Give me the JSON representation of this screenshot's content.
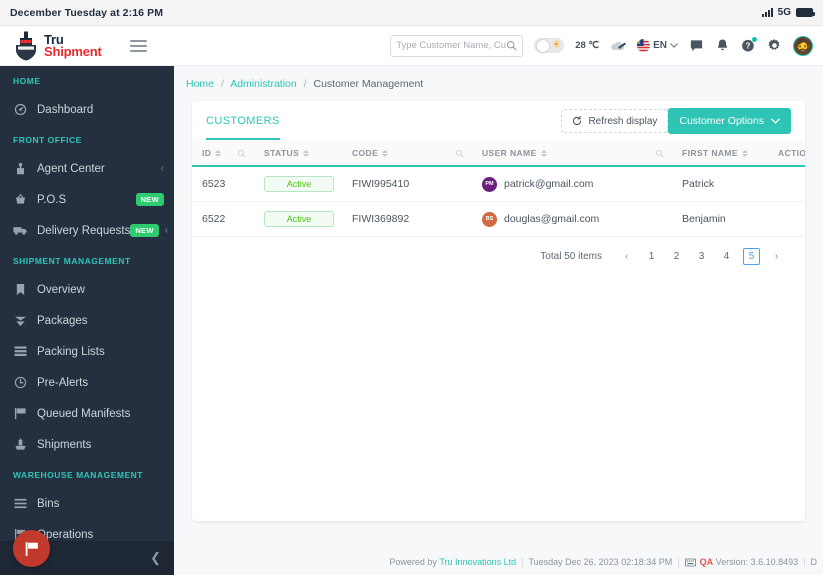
{
  "statusbar": {
    "clock": "December Tuesday at 2:16 PM",
    "network": "5G",
    "signal_icon": "signal-bars-icon",
    "battery_icon": "battery-icon"
  },
  "header": {
    "logo": {
      "line1": "Tru",
      "line2": "Shipment",
      "icon": "ship-shield-logo-icon"
    },
    "menu_toggle_icon": "hamburger-menu-icon",
    "search": {
      "placeholder": "Type Customer Name, Cu...",
      "value": "",
      "icon": "search-icon"
    },
    "theme_toggle": {
      "state": "off",
      "icon": "sun-icon"
    },
    "weather": {
      "temperature": "28 ℃",
      "icon": "cloud-icon"
    },
    "language": {
      "code": "EN",
      "flag": "malaysia-flag-icon",
      "chevron": "chevron-down-icon"
    },
    "icons": [
      {
        "name": "chat-icon",
        "badge": false
      },
      {
        "name": "bell-icon",
        "badge": false
      },
      {
        "name": "help-icon",
        "badge": true
      },
      {
        "name": "gear-icon",
        "badge": false
      }
    ],
    "avatar": {
      "name": "user-avatar",
      "glyph": "🧔"
    }
  },
  "sidebar": {
    "sections": [
      {
        "title": "HOME",
        "items": [
          {
            "label": "Dashboard",
            "icon": "speedometer-icon",
            "badge": null,
            "arrow": false
          }
        ]
      },
      {
        "title": "FRONT OFFICE",
        "items": [
          {
            "label": "Agent Center",
            "icon": "agent-icon",
            "badge": null,
            "arrow": true
          },
          {
            "label": "P.O.S",
            "icon": "basket-icon",
            "badge": "NEW",
            "arrow": false
          },
          {
            "label": "Delivery Requests",
            "icon": "truck-icon",
            "badge": "NEW",
            "arrow": true
          }
        ]
      },
      {
        "title": "SHIPMENT MANAGEMENT",
        "items": [
          {
            "label": "Overview",
            "icon": "bookmark-icon",
            "badge": null,
            "arrow": false
          },
          {
            "label": "Packages",
            "icon": "package-icon",
            "badge": null,
            "arrow": false
          },
          {
            "label": "Packing Lists",
            "icon": "list-icon",
            "badge": null,
            "arrow": false
          },
          {
            "label": "Pre-Alerts",
            "icon": "clock-icon",
            "badge": null,
            "arrow": false
          },
          {
            "label": "Queued Manifests",
            "icon": "flag-icon",
            "badge": null,
            "arrow": false
          },
          {
            "label": "Shipments",
            "icon": "shipment-icon",
            "badge": null,
            "arrow": false
          }
        ]
      },
      {
        "title": "WAREHOUSE MANAGEMENT",
        "items": [
          {
            "label": "Bins",
            "icon": "bins-icon",
            "badge": null,
            "arrow": false
          },
          {
            "label": "Operations",
            "icon": "operations-icon",
            "badge": null,
            "arrow": false
          }
        ]
      }
    ],
    "collapse_icon": "chevron-left-icon",
    "fab_icon": "flag-icon"
  },
  "breadcrumb": {
    "home": "Home",
    "administration": "Administration",
    "current": "Customer Management"
  },
  "card": {
    "tab": "CUSTOMERS",
    "refresh_label": "Refresh display",
    "refresh_icon": "refresh-icon",
    "options_label": "Customer Options",
    "options_chevron": "chevron-down-icon",
    "columns": [
      "ID",
      "STATUS",
      "CODE",
      "USER NAME",
      "FIRST NAME",
      "ACTION"
    ],
    "rows": [
      {
        "id": "6523",
        "status": "Active",
        "code": "FIWI995410",
        "username": "patrick@gmail.com",
        "avatar_initials": "PM",
        "avatar_color": "#6b1f7a",
        "firstname": "Patrick",
        "action_icon": "kebab-menu-icon"
      },
      {
        "id": "6522",
        "status": "Active",
        "code": "FIWI369892",
        "username": "douglas@gmail.com",
        "avatar_initials": "BS",
        "avatar_color": "#d2693f",
        "firstname": "Benjamin",
        "action_icon": "kebab-menu-icon"
      }
    ],
    "pagination": {
      "total_label": "Total 50 items",
      "prev_icon": "chevron-left-icon",
      "next_icon": "chevron-right-icon",
      "pages": [
        "1",
        "2",
        "3",
        "4",
        "5"
      ],
      "current": "5"
    }
  },
  "footer": {
    "powered_by": "Powered by",
    "company": "Tru Innovations Ltd",
    "timestamp": "Tuesday Dec 26, 2023 02:18:34 PM",
    "keyboard_icon": "keyboard-icon",
    "env": "QA",
    "version": "Version: 3.6.10.8493",
    "trailing": "D"
  },
  "colors": {
    "accent": "#2ec5b6",
    "sidebar": "#24303f",
    "brand_red": "#e8292f",
    "success": "#52c41a"
  }
}
